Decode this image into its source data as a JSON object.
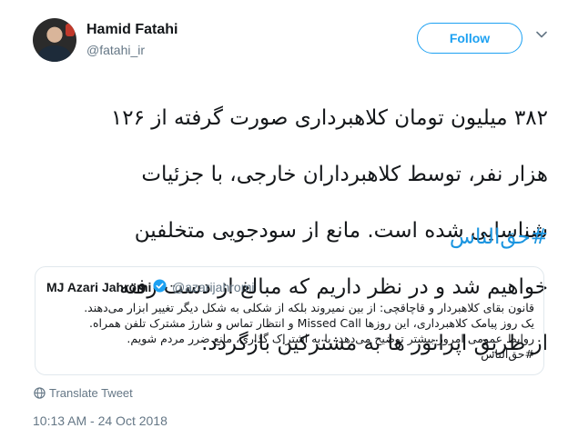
{
  "author": {
    "name": "Hamid Fatahi",
    "handle": "@fatahi_ir",
    "follow_label": "Follow"
  },
  "tweet": {
    "lines": [
      "۳۸۲ میلیون تومان کلاهبرداری صورت گرفته از ۱۲۶",
      "هزار نفر، توسط کلاهبرداران خارجی، با جزئیات",
      "شناسایی شده است. مانع از سودجویی متخلفین",
      "خواهیم شد و در نظر داریم که مبالغ از دست رفته",
      "از طریق اپراتور ها به مشترکین بازگردد."
    ],
    "hashtag": "#حق‌الناس"
  },
  "quote": {
    "name": "MJ Azari Jahromi",
    "handle": "@azarijahromi",
    "lines": [
      "قانون بقای کلاهبردار و قاچاقچی: از بین نمیروند بلکه از شکلی به شکل دیگر تغییر ابزار می‌دهند.",
      "یک روز پیامک کلاهبرداری، این روزها Missed Call و انتظار تماس و شارژ مشترک تلفن همراه.",
      "روابط عمومی امروز بیشتر توضیح می‌دهد. با به اشتراک گذاری، مانع ضرر مردم شویم.",
      "#حق‌الناس"
    ]
  },
  "translate_label": "Translate Tweet",
  "timestamp": "10:13 AM - 24 Oct 2018",
  "colors": {
    "accent": "#1da1f2",
    "hashtag": "#1b95e0",
    "secondary_text": "#657786",
    "border": "#e1e8ed"
  },
  "icons": [
    "chevron-down-icon",
    "verified-badge-icon",
    "globe-icon"
  ]
}
